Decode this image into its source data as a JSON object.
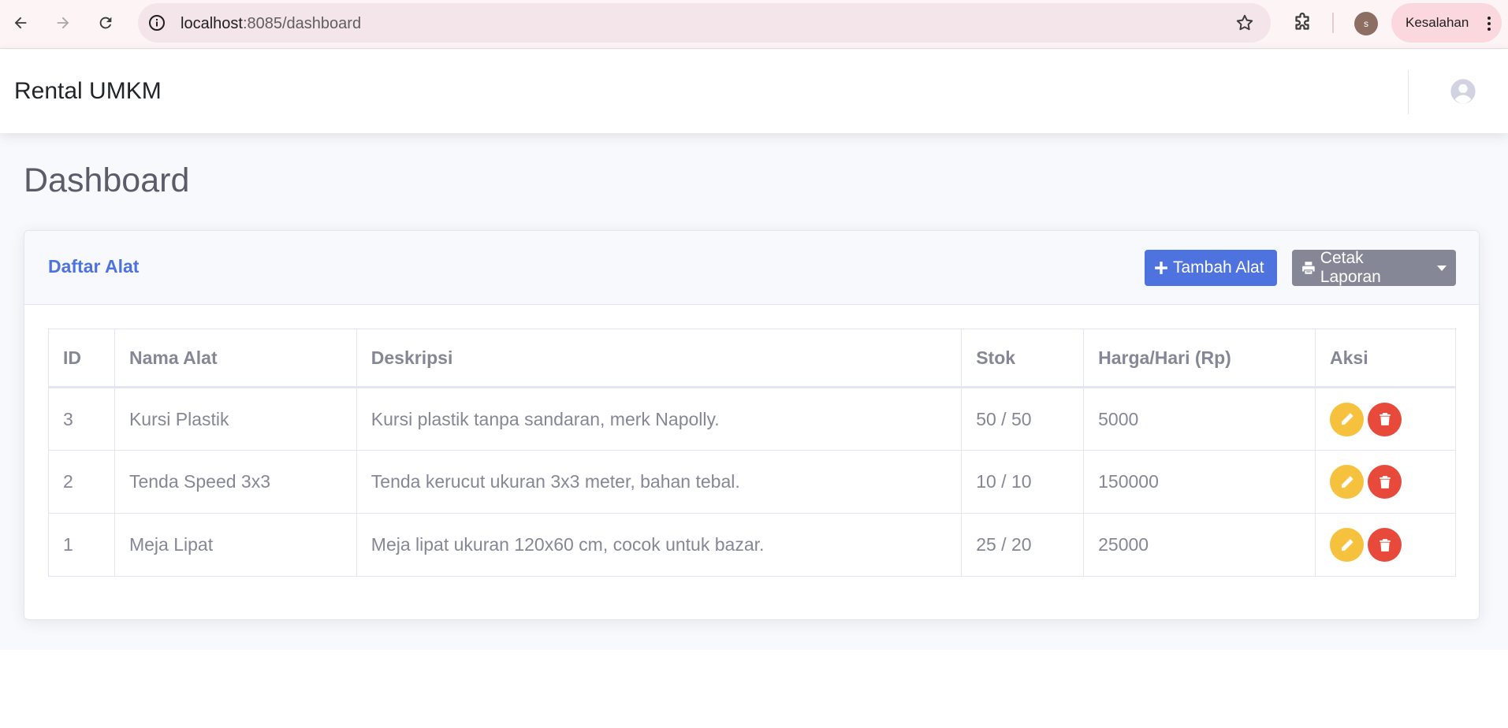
{
  "browser": {
    "url_host": "localhost",
    "url_rest": ":8085/dashboard",
    "profile_initial": "s",
    "error_label": "Kesalahan"
  },
  "topbar": {
    "brand": "Rental UMKM"
  },
  "page": {
    "title": "Dashboard"
  },
  "card": {
    "title": "Daftar Alat",
    "add_button": "Tambah Alat",
    "report_button": "Cetak Laporan"
  },
  "table": {
    "headers": [
      "ID",
      "Nama Alat",
      "Deskripsi",
      "Stok",
      "Harga/Hari (Rp)",
      "Aksi"
    ],
    "rows": [
      {
        "id": "3",
        "name": "Kursi Plastik",
        "description": "Kursi plastik tanpa sandaran, merk Napolly.",
        "stock": "50 / 50",
        "price": "5000"
      },
      {
        "id": "2",
        "name": "Tenda Speed 3x3",
        "description": "Tenda kerucut ukuran 3x3 meter, bahan tebal.",
        "stock": "10 / 10",
        "price": "150000"
      },
      {
        "id": "1",
        "name": "Meja Lipat",
        "description": "Meja lipat ukuran 120x60 cm, cocok untuk bazar.",
        "stock": "25 / 20",
        "price": "25000"
      }
    ]
  },
  "colors": {
    "primary": "#4e73df",
    "secondary": "#858796",
    "warning": "#f6c23e",
    "danger": "#e74a3b"
  },
  "icons": {
    "back": "arrow-left-icon",
    "forward": "arrow-right-icon",
    "reload": "reload-icon",
    "site_info": "info-icon",
    "bookmark": "star-icon",
    "extensions": "puzzle-icon",
    "menu": "three-dots-icon",
    "user": "user-circle-icon",
    "add": "plus-icon",
    "print": "printer-icon",
    "edit": "pencil-icon",
    "delete": "trash-icon"
  }
}
